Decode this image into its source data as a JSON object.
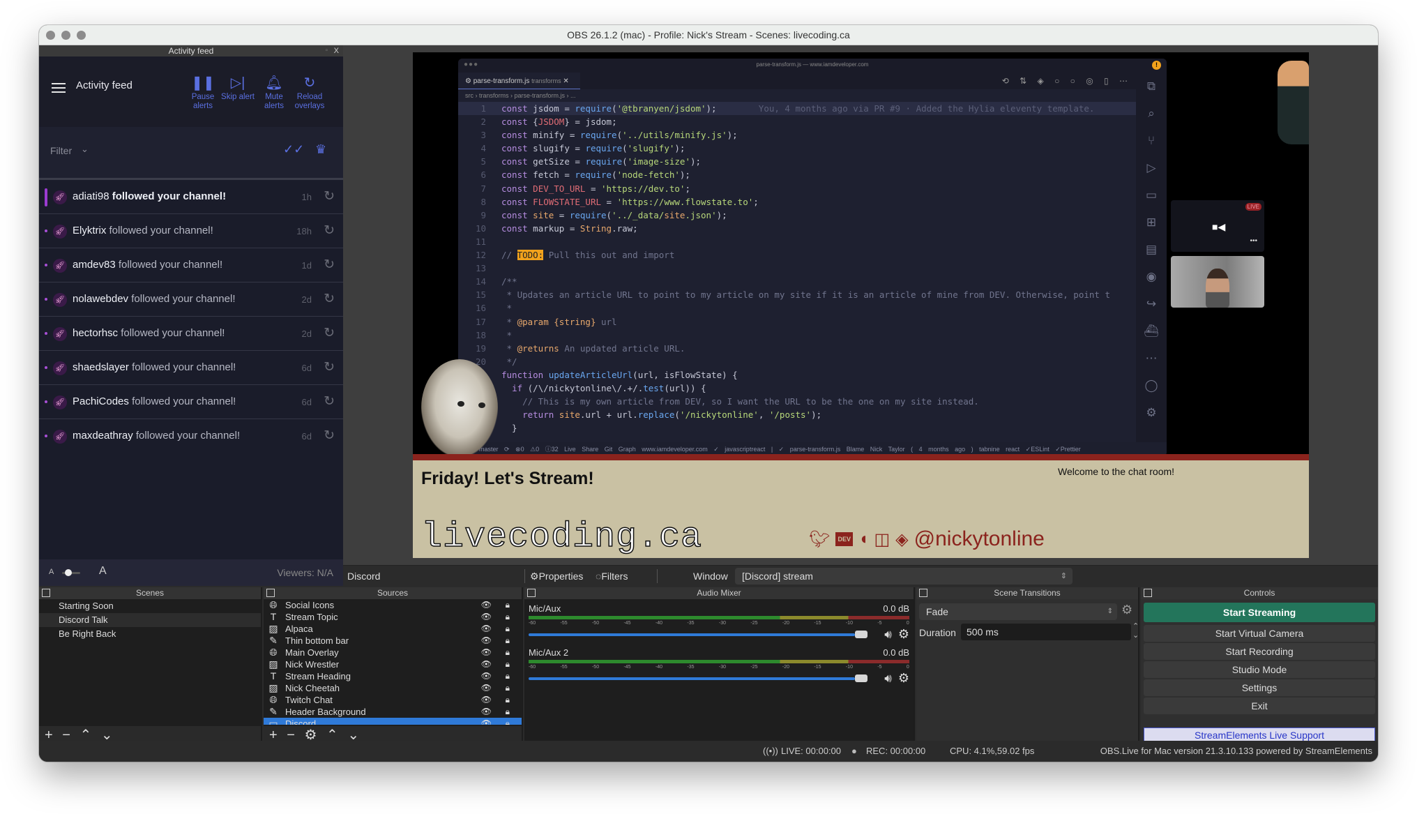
{
  "window": {
    "title": "OBS 26.1.2 (mac) - Profile: Nick's Stream - Scenes: livecoding.ca"
  },
  "activity_feed": {
    "dock_title": "Activity feed",
    "dock_close": "X",
    "title": "Activity feed",
    "buttons": [
      {
        "icon": "pause-icon",
        "glyph": "❚❚",
        "label": "Pause alerts"
      },
      {
        "icon": "skip-icon",
        "glyph": "▷|",
        "label": "Skip alert"
      },
      {
        "icon": "bell-icon",
        "glyph": "🔔︎",
        "label": "Mute alerts"
      },
      {
        "icon": "reload-icon",
        "glyph": "↻",
        "label": "Reload overlays"
      }
    ],
    "filter_label": "Filter",
    "items": [
      {
        "user": "adiati98",
        "action": "followed your channel!",
        "time": "1h"
      },
      {
        "user": "Elyktrix",
        "action": "followed your channel!",
        "time": "18h"
      },
      {
        "user": "amdev83",
        "action": "followed your channel!",
        "time": "1d"
      },
      {
        "user": "nolawebdev",
        "action": "followed your channel!",
        "time": "2d"
      },
      {
        "user": "hectorhsc",
        "action": "followed your channel!",
        "time": "2d"
      },
      {
        "user": "shaedslayer",
        "action": "followed your channel!",
        "time": "6d"
      },
      {
        "user": "PachiCodes",
        "action": "followed your channel!",
        "time": "6d"
      },
      {
        "user": "maxdeathray",
        "action": "followed your channel!",
        "time": "6d"
      }
    ],
    "font_small": "A",
    "font_large": "A",
    "viewers": "Viewers: N/A"
  },
  "editor": {
    "window_title": "parse-transform.js — www.iamdeveloper.com",
    "tab": "parse-transform.js",
    "tab_folder": "transforms",
    "breadcrumb": "src › transforms › parse-transform.js › ...",
    "blame": "You, 4 months ago via PR #9 · Added the Hylia eleventy template.",
    "lines": [
      "const jsdom = require('@tbranyen/jsdom');",
      "const {JSDOM} = jsdom;",
      "const minify = require('../utils/minify.js');",
      "const slugify = require('slugify');",
      "const getSize = require('image-size');",
      "const fetch = require('node-fetch');",
      "const DEV_TO_URL = 'https://dev.to';",
      "const FLOWSTATE_URL = 'https://www.flowstate.to';",
      "const site = require('../_data/site.json');",
      "const markup = String.raw;",
      "",
      "// TODO: Pull this out and import",
      "",
      "/**",
      " * Updates an article URL to point to my article on my site if it is an article of mine from DEV. Otherwise, point t",
      " *",
      " * @param {string} url",
      " *",
      " * @returns An updated article URL.",
      " */",
      "function updateArticleUrl(url, isFlowState) {",
      "  if (/\\/nickytonline\\/.+/.test(url)) {",
      "    // This is my own article from DEV, so I want the URL to be the one on my site instead.",
      "    return site.url + url.replace('/nickytonline', '/posts');",
      "  }"
    ],
    "status_bar": "master  ⟳  ⊗0 ⚠0 ⓘ32  Live Share  Git Graph  www.iamdeveloper.com  ✓ javascriptreact | ✓ parse-transform.js  Blame Nick Taylor ( 4 months ago )  tabnine  react  ✓ESLint  ✓Prettier"
  },
  "overlay": {
    "discord_live": "LIVE",
    "heading": "Friday! Let's Stream!",
    "chat_welcome": "Welcome to the chat room!",
    "brand": "livecoding.ca",
    "handle": "@nickytonline",
    "accent": "#8b231d",
    "bg": "#c9c1a3"
  },
  "source_toolbar": {
    "selected_source": "Discord",
    "properties": "Properties",
    "filters": "Filters",
    "window_label": "Window",
    "window_value": "[Discord] stream"
  },
  "scenes": {
    "title": "Scenes",
    "items": [
      "Starting Soon",
      "Discord Talk",
      "Be Right Back"
    ],
    "selected": "Discord Talk"
  },
  "sources": {
    "title": "Sources",
    "items": [
      {
        "name": "Social Icons",
        "type": "browser"
      },
      {
        "name": "Stream Topic",
        "type": "text"
      },
      {
        "name": "Alpaca",
        "type": "image"
      },
      {
        "name": "Thin bottom bar",
        "type": "color"
      },
      {
        "name": "Main Overlay",
        "type": "browser"
      },
      {
        "name": "Nick Wrestler",
        "type": "image"
      },
      {
        "name": "Stream Heading",
        "type": "text"
      },
      {
        "name": "Nick Cheetah",
        "type": "image"
      },
      {
        "name": "Twitch Chat",
        "type": "browser"
      },
      {
        "name": "Header Background",
        "type": "color"
      },
      {
        "name": "Discord",
        "type": "window"
      }
    ],
    "selected": "Discord"
  },
  "audio_mixer": {
    "title": "Audio Mixer",
    "channels": [
      {
        "name": "Mic/Aux",
        "level": "0.0 dB",
        "volume_fraction": 1.0
      },
      {
        "name": "Mic/Aux 2",
        "level": "0.0 dB",
        "volume_fraction": 1.0
      }
    ],
    "ticks": [
      "-60",
      "-55",
      "-50",
      "-45",
      "-40",
      "-35",
      "-30",
      "-25",
      "-20",
      "-15",
      "-10",
      "-5",
      "0"
    ]
  },
  "transitions": {
    "title": "Scene Transitions",
    "selected": "Fade",
    "duration_label": "Duration",
    "duration_value": "500 ms"
  },
  "controls": {
    "title": "Controls",
    "buttons": [
      "Start Streaming",
      "Start Virtual Camera",
      "Start Recording",
      "Studio Mode",
      "Settings",
      "Exit"
    ],
    "support": "StreamElements Live Support"
  },
  "status": {
    "live": "LIVE: 00:00:00",
    "rec": "REC: 00:00:00",
    "cpu": "CPU: 4.1%,59.02 fps",
    "version": "OBS.Live for Mac version 21.3.10.133 powered by StreamElements"
  }
}
